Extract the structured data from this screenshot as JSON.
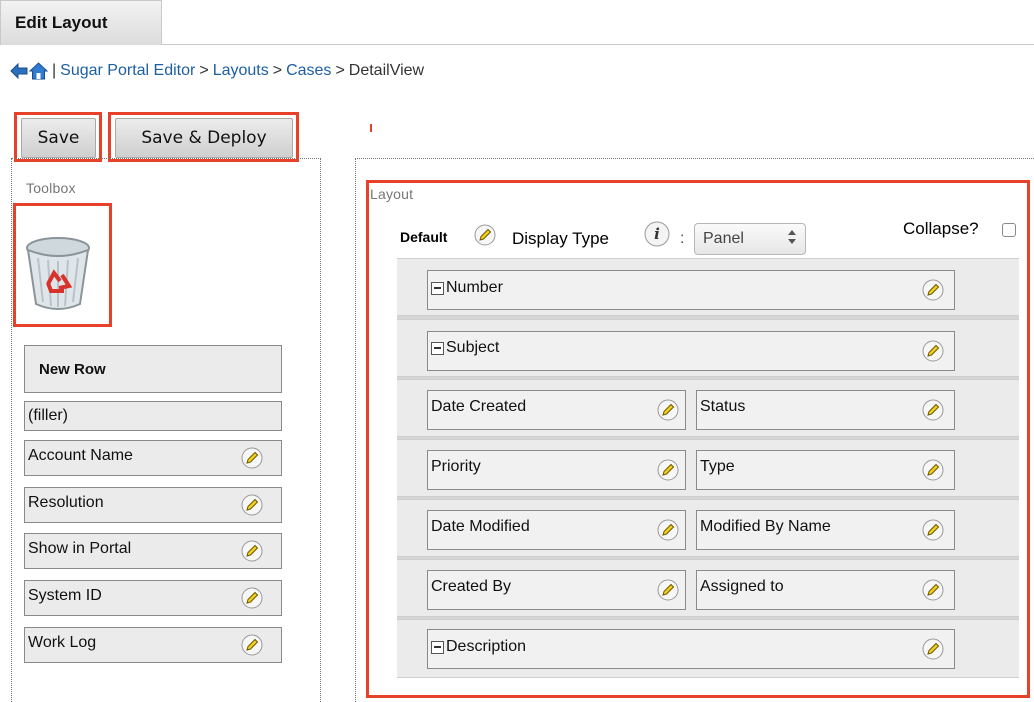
{
  "tab": {
    "label": "Edit Layout"
  },
  "breadcrumb": {
    "items": [
      "Sugar Portal Editor",
      "Layouts",
      "Cases"
    ],
    "separator": "|",
    "arrow": ">",
    "current": "DetailView"
  },
  "toolbar": {
    "save_label": "Save",
    "save_deploy_label": "Save & Deploy"
  },
  "toolbox": {
    "title": "Toolbox",
    "new_row": "New Row",
    "filler": "(filler)",
    "fields": [
      "Account Name",
      "Resolution",
      "Show in Portal",
      "System ID",
      "Work Log"
    ]
  },
  "layout": {
    "title": "Layout",
    "panel_name": "Default",
    "display_type_label": "Display Type",
    "colon": ":",
    "display_type_value": "Panel",
    "collapse_label": "Collapse?",
    "rows": [
      {
        "full": "Number"
      },
      {
        "full": "Subject"
      },
      {
        "left": "Date Created",
        "right": "Status"
      },
      {
        "left": "Priority",
        "right": "Type"
      },
      {
        "left": "Date Modified",
        "right": "Modified By Name"
      },
      {
        "left": "Created By",
        "right": "Assigned to"
      },
      {
        "full": "Description"
      }
    ]
  },
  "colors": {
    "highlight": "#e8412a",
    "link": "#1d5fa3",
    "panel_bg": "#d6d6d6"
  },
  "icons": [
    "back-arrow-icon",
    "home-icon",
    "trash-icon",
    "pencil-icon",
    "info-icon",
    "minus-icon"
  ]
}
